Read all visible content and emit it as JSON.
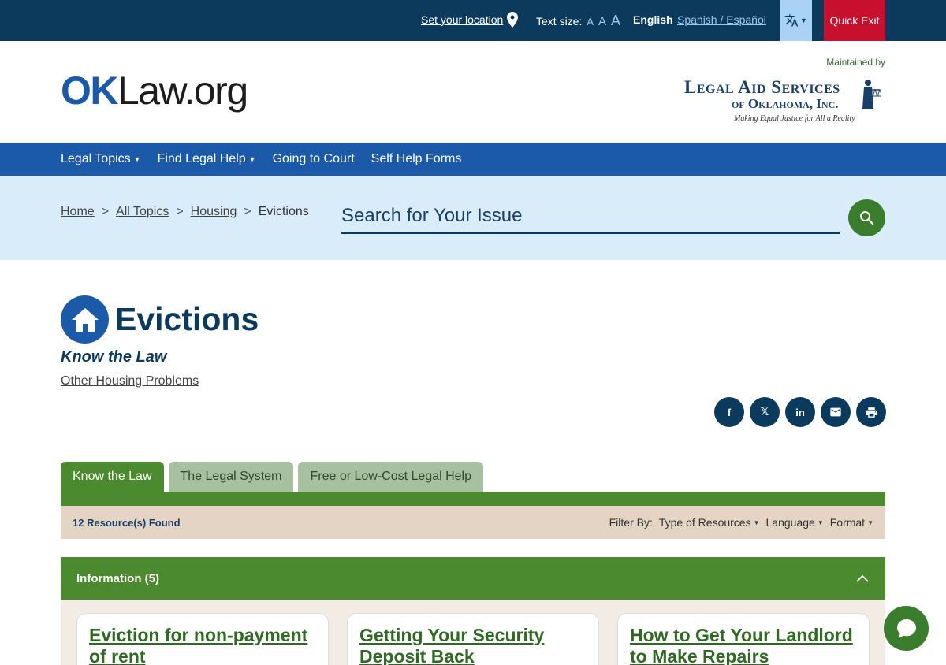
{
  "utility": {
    "location_label": "Set your location",
    "text_size_label": "Text size:",
    "text_size_small": "A",
    "text_size_medium": "A",
    "text_size_large": "A",
    "lang_current": "English",
    "lang_alt": "Spanish / Español",
    "translate_icon": "translate-icon",
    "quick_exit": "Quick Exit"
  },
  "header": {
    "logo_ok": "OK",
    "logo_rest": "Law.org",
    "maintained_by": "Maintained by",
    "partner_line1": "Legal Aid Services",
    "partner_line2": "of Oklahoma, Inc.",
    "partner_tagline": "Making Equal Justice for All a Reality"
  },
  "nav": {
    "items": [
      {
        "label": "Legal Topics",
        "dropdown": true
      },
      {
        "label": "Find Legal Help",
        "dropdown": true
      },
      {
        "label": "Going to Court",
        "dropdown": false
      },
      {
        "label": "Self Help Forms",
        "dropdown": false
      }
    ]
  },
  "breadcrumb": {
    "items": [
      "Home",
      "All Topics",
      "Housing",
      "Evictions"
    ],
    "separator": ">"
  },
  "search": {
    "placeholder": "Search for Your Issue"
  },
  "page": {
    "title": "Evictions",
    "subtitle": "Know the Law",
    "related_link": "Other Housing Problems"
  },
  "share": {
    "facebook": "f",
    "x": "𝕏",
    "linkedin": "in"
  },
  "tabs": [
    {
      "label": "Know the Law",
      "active": true
    },
    {
      "label": "The Legal System",
      "active": false
    },
    {
      "label": "Free or Low-Cost Legal Help",
      "active": false
    }
  ],
  "filter": {
    "found": "12 Resource(s) Found",
    "label": "Filter By:",
    "type": "Type of Resources",
    "language": "Language",
    "format": "Format"
  },
  "section": {
    "title": "Information (5)"
  },
  "cards": [
    {
      "title": "Eviction for non-payment of rent"
    },
    {
      "title": "Getting Your Security Deposit Back"
    },
    {
      "title": "How to Get Your Landlord to Make Repairs"
    }
  ],
  "colors": {
    "top_bar": "#0b3a5c",
    "nav": "#1a5aa8",
    "green": "#4b8a2f",
    "quick_exit": "#c8102e"
  }
}
